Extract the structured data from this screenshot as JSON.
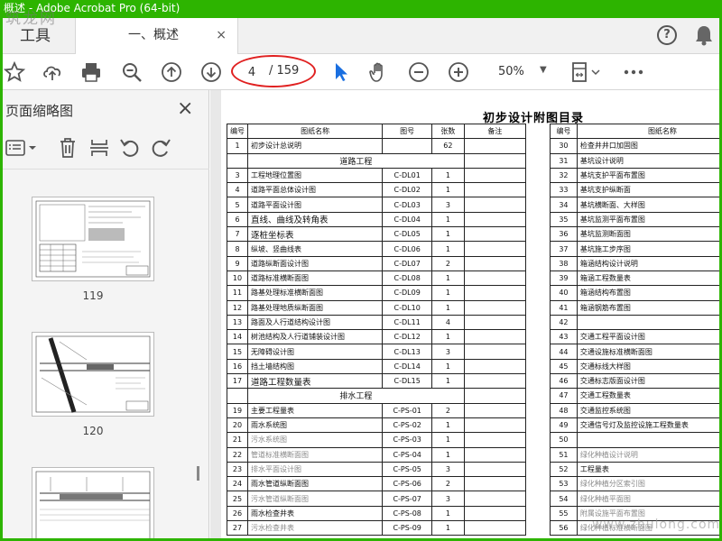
{
  "window": {
    "title": "概述 - Adobe Acrobat Pro (64-bit)",
    "watermark_top": "筑龙网",
    "watermark_bottom": "www.zhulong.com"
  },
  "tabs": {
    "tools": "工具",
    "document": "一、概述",
    "close": "×"
  },
  "toolbar": {
    "page_current": "4",
    "page_total": "/ 159",
    "zoom": "50%",
    "icons": [
      "star-icon",
      "upload-icon",
      "print-icon",
      "zoom-out-search-icon",
      "page-up-icon",
      "page-down-icon",
      "select-cursor-icon",
      "hand-icon",
      "zoom-out-icon",
      "zoom-in-icon",
      "fit-page-icon",
      "more-icon"
    ]
  },
  "sidepanel": {
    "title": "页面缩略图",
    "thumbnails": [
      {
        "label": "119"
      },
      {
        "label": "120"
      }
    ]
  },
  "document": {
    "title": "初步设计附图目录",
    "left_headers": [
      "编号",
      "图纸名称",
      "图号",
      "张数",
      "备注"
    ],
    "right_headers": [
      "编号",
      "图纸名称"
    ],
    "left_rows": [
      {
        "no": "1",
        "name": "初步设计总说明",
        "code": "",
        "count": "62",
        "note": ""
      },
      {
        "section": "道路工程"
      },
      {
        "no": "3",
        "name": "工程地理位置图",
        "code": "C-DL01",
        "count": "1"
      },
      {
        "no": "4",
        "name": "道路平面总体设计图",
        "code": "C-DL02",
        "count": "1"
      },
      {
        "no": "5",
        "name": "道路平面设计图",
        "code": "C-DL03",
        "count": "3"
      },
      {
        "no": "6",
        "name": "直线、曲线及转角表",
        "code": "C-DL04",
        "count": "1",
        "big": true
      },
      {
        "no": "7",
        "name": "逐桩坐标表",
        "code": "C-DL05",
        "count": "1",
        "big": true
      },
      {
        "no": "8",
        "name": "纵坡、竖曲线表",
        "code": "C-DL06",
        "count": "1"
      },
      {
        "no": "9",
        "name": "道路纵断面设计图",
        "code": "C-DL07",
        "count": "2"
      },
      {
        "no": "10",
        "name": "道路标准横断面图",
        "code": "C-DL08",
        "count": "1"
      },
      {
        "no": "11",
        "name": "路基处理标准横断面图",
        "code": "C-DL09",
        "count": "1"
      },
      {
        "no": "12",
        "name": "路基处理地质纵断面图",
        "code": "C-DL10",
        "count": "1"
      },
      {
        "no": "13",
        "name": "路面及人行道结构设计图",
        "code": "C-DL11",
        "count": "4"
      },
      {
        "no": "14",
        "name": "树池结构及人行道铺装设计图",
        "code": "C-DL12",
        "count": "1"
      },
      {
        "no": "15",
        "name": "无障碍设计图",
        "code": "C-DL13",
        "count": "3"
      },
      {
        "no": "16",
        "name": "挡土墙结构图",
        "code": "C-DL14",
        "count": "1"
      },
      {
        "no": "17",
        "name": "道路工程数量表",
        "code": "C-DL15",
        "count": "1",
        "big": true
      },
      {
        "section": "排水工程"
      },
      {
        "no": "19",
        "name": "主要工程量表",
        "code": "C-PS-01",
        "count": "2"
      },
      {
        "no": "20",
        "name": "雨水系统图",
        "code": "C-PS-02",
        "count": "1"
      },
      {
        "no": "21",
        "name": "污水系统图",
        "code": "C-PS-03",
        "count": "1",
        "grey": true
      },
      {
        "no": "22",
        "name": "管道标准横断面图",
        "code": "C-PS-04",
        "count": "1",
        "grey": true
      },
      {
        "no": "23",
        "name": "排水平面设计图",
        "code": "C-PS-05",
        "count": "3",
        "grey": true
      },
      {
        "no": "24",
        "name": "雨水管道纵断面图",
        "code": "C-PS-06",
        "count": "2"
      },
      {
        "no": "25",
        "name": "污水管道纵断面图",
        "code": "C-PS-07",
        "count": "3",
        "grey": true
      },
      {
        "no": "26",
        "name": "雨水检查井表",
        "code": "C-PS-08",
        "count": "1"
      },
      {
        "no": "27",
        "name": "污水检查井表",
        "code": "C-PS-09",
        "count": "1",
        "grey": true
      }
    ],
    "right_rows": [
      {
        "no": "30",
        "name": "检查井井口加固图"
      },
      {
        "no": "31",
        "name": "基坑设计说明"
      },
      {
        "no": "32",
        "name": "基坑支护平面布置图"
      },
      {
        "no": "33",
        "name": "基坑支护纵断面"
      },
      {
        "no": "34",
        "name": "基坑横断面、大样图"
      },
      {
        "no": "35",
        "name": "基坑监测平面布置图"
      },
      {
        "no": "36",
        "name": "基坑监测断面图"
      },
      {
        "no": "37",
        "name": "基坑施工步序图"
      },
      {
        "no": "38",
        "name": "箱涵结构设计说明"
      },
      {
        "no": "39",
        "name": "箱涵工程数量表"
      },
      {
        "no": "40",
        "name": "箱涵结构布置图"
      },
      {
        "no": "41",
        "name": "箱涵钢筋布置图"
      },
      {
        "no": "42",
        "section": "交通工"
      },
      {
        "no": "43",
        "name": "交通工程平面设计图"
      },
      {
        "no": "44",
        "name": "交通设施标准横断面图"
      },
      {
        "no": "45",
        "name": "交通标线大样图"
      },
      {
        "no": "46",
        "name": "交通标志版面设计图"
      },
      {
        "no": "47",
        "name": "交通工程数量表"
      },
      {
        "no": "48",
        "name": "交通监控系统图"
      },
      {
        "no": "49",
        "name": "交通信号灯及监控设施工程数量表"
      },
      {
        "no": "50",
        "section": "绿化"
      },
      {
        "no": "51",
        "name": "绿化种植设计说明",
        "grey": true
      },
      {
        "no": "52",
        "name": "工程量表"
      },
      {
        "no": "53",
        "name": "绿化种植分区索引图",
        "grey": true
      },
      {
        "no": "54",
        "name": "绿化种植平面图",
        "grey": true
      },
      {
        "no": "55",
        "name": "附属设施平面布置图",
        "grey": true
      },
      {
        "no": "56",
        "name": "绿化种植标准横断面图",
        "grey": true
      }
    ]
  }
}
